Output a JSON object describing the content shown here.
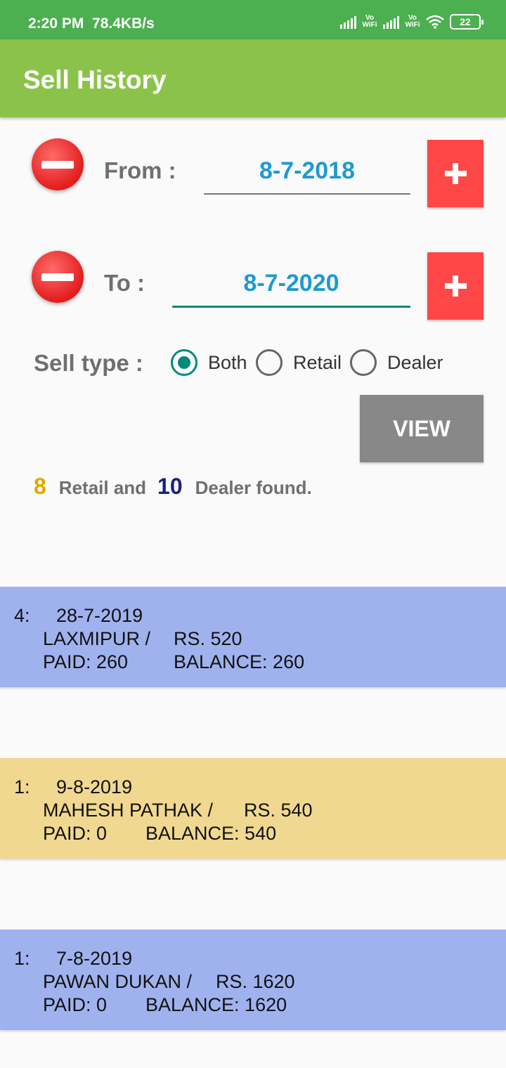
{
  "status_bar": {
    "time": "2:20 PM",
    "speed": "78.4KB/s",
    "vo_wifi": "Vo WiFi",
    "battery": "22"
  },
  "app_bar": {
    "title": "Sell History"
  },
  "from": {
    "label": "From :",
    "date": "8-7-2018"
  },
  "to": {
    "label": "To :",
    "date": "8-7-2020"
  },
  "sell_type": {
    "label": "Sell type :",
    "options": [
      "Both",
      "Retail",
      "Dealer"
    ],
    "selected": "Both"
  },
  "view_button": "VIEW",
  "summary": {
    "retail_count": "8",
    "retail_text": "Retail and",
    "dealer_count": "10",
    "dealer_text": "Dealer found."
  },
  "colors": {
    "status_bar": "#4caf50",
    "app_bar": "#8bc34a",
    "dealer_card": "#a0b2ee",
    "retail_card": "#f0d890",
    "accent": "#00897b",
    "danger": "#ff4747"
  },
  "records": [
    {
      "type": "dealer",
      "index": "4:",
      "date": "28-7-2019",
      "name": "LAXMIPUR /",
      "amount": "RS. 520",
      "paid": "PAID:  260",
      "balance": "BALANCE:  260"
    },
    {
      "type": "retail",
      "index": "1:",
      "date": "9-8-2019",
      "name": "MAHESH PATHAK  /",
      "amount": "RS. 540",
      "paid": "PAID:  0",
      "balance": "BALANCE:  540"
    },
    {
      "type": "dealer",
      "index": "1:",
      "date": "7-8-2019",
      "name": "PAWAN DUKAN  /",
      "amount": "RS. 1620",
      "paid": "PAID:  0",
      "balance": "BALANCE:  1620"
    }
  ]
}
